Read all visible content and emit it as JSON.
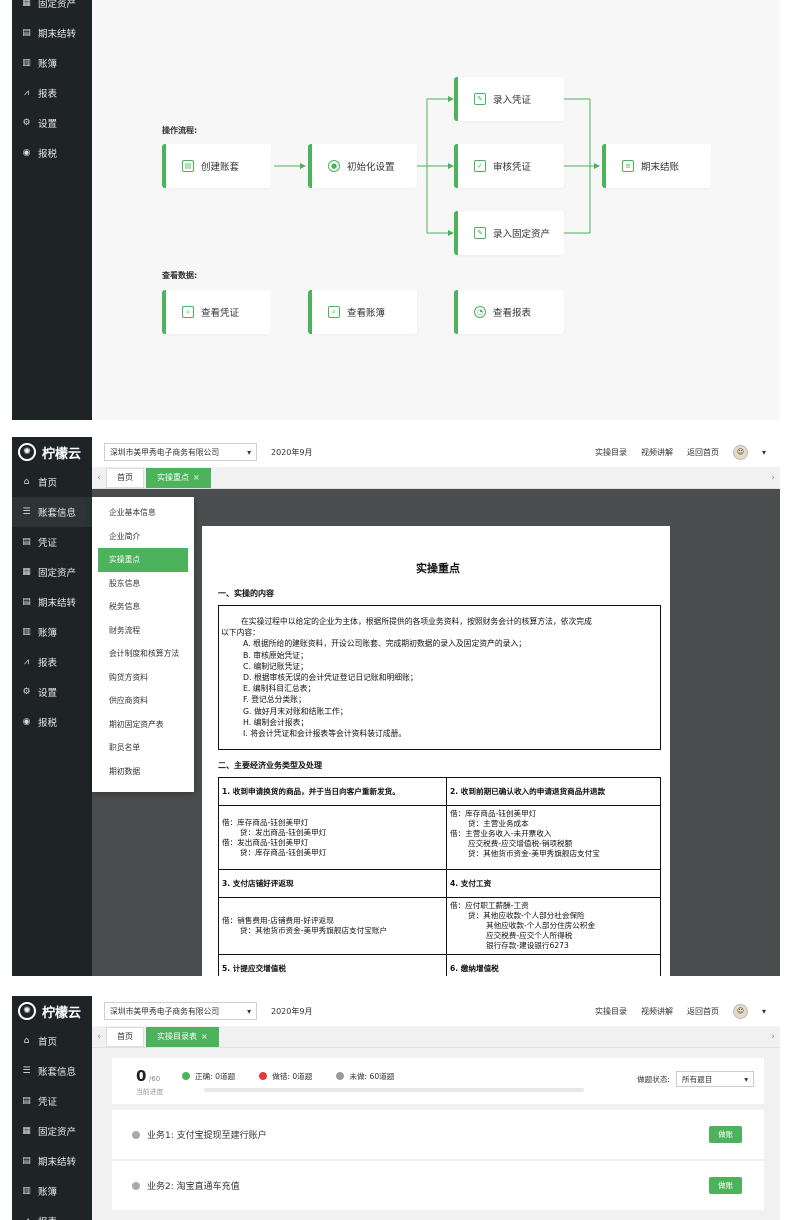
{
  "nav": [
    {
      "label": "首页",
      "icon": "home-icon"
    },
    {
      "label": "账套信息",
      "icon": "sliders-icon"
    },
    {
      "label": "凭证",
      "icon": "document-icon"
    },
    {
      "label": "固定资产",
      "icon": "building-icon"
    },
    {
      "label": "期末结转",
      "icon": "calendar-icon"
    },
    {
      "label": "账簿",
      "icon": "book-icon"
    },
    {
      "label": "报表",
      "icon": "chart-icon"
    },
    {
      "label": "设置",
      "icon": "gear-icon"
    },
    {
      "label": "报税",
      "icon": "tax-icon"
    }
  ],
  "brand": "柠檬云",
  "flow": {
    "operate_label": "操作流程:",
    "view_label": "查看数据:",
    "steps": {
      "create": "创建账套",
      "init": "初始化设置",
      "voucher_in": "录入凭证",
      "audit": "审核凭证",
      "asset_in": "录入固定资产",
      "close": "期末结账"
    },
    "views": {
      "voucher": "查看凭证",
      "books": "查看账簿",
      "report": "查看报表"
    }
  },
  "topbar": {
    "company": "深圳市美甲秀电子商务有限公司",
    "period": "2020年9月",
    "links": [
      "实操目录",
      "视频讲解",
      "返回首页"
    ]
  },
  "tabs_p2": [
    "首页",
    "实操重点"
  ],
  "tabs_p3": [
    "首页",
    "实操目录表"
  ],
  "dropdown": [
    "企业基本信息",
    "企业简介",
    "实操重点",
    "股东信息",
    "税务信息",
    "财务流程",
    "会计制度和核算方法",
    "购货方资料",
    "供应商资料",
    "期初固定资产表",
    "职员名单",
    "期初数据"
  ],
  "doc": {
    "title": "实操重点",
    "sec1": "一、实操的内容",
    "intro1": "在实操过程中以给定的企业为主体，根据所提供的各项业务资料，按照财务会计的核算方法，依次完成",
    "intro2": "以下内容：",
    "items": [
      "A. 根据所给的建账资料，开设公司账套、完成期初数据的录入及固定资产的录入；",
      "B. 审核原始凭证；",
      "C. 编制记账凭证；",
      "D. 根据审核无误的会计凭证登记日记账和明细账；",
      "E. 编制科目汇总表；",
      "F. 登记总分类账；",
      "G. 做好月末对账和结账工作；",
      "H. 编制会计报表；",
      "I. 将会计凭证和会计报表等会计资料装订成册。"
    ],
    "sec2": "二、主要经济业务类型及处理",
    "t": {
      "h1": "1. 收到申请换货的商品，并于当日向客户重新发货。",
      "h2": "2. 收到前期已确认收入的申请退货商品并退款",
      "c1": [
        "借：库存商品-钰创美甲灯",
        "贷：发出商品-钰创美甲灯",
        "借：发出商品-钰创美甲灯",
        "贷：库存商品-钰创美甲灯"
      ],
      "c2": [
        "借：库存商品-钰创美甲灯",
        "贷：主营业务成本",
        "借：主营业务收入-未开票收入",
        "应交税费-应交增值税-销项税额",
        "贷：其他货币资金-美甲秀旗舰店支付宝"
      ],
      "h3": "3. 支付店铺好评返现",
      "h4": "4. 支付工资",
      "c3": [
        "借：销售费用-店铺费用-好评返现",
        "贷：其他货币资金-美甲秀旗舰店支付宝账户"
      ],
      "c4": [
        "借：应付职工薪酬-工资",
        "贷：其他应收款-个人部分社会保险",
        "其他应收款-个人部分住房公积金",
        "应交税费-应交个人所得税",
        "银行存款-建设银行6273"
      ],
      "h5": "5. 计提应交增值税",
      "h6": "6. 缴纳增值税"
    }
  },
  "practice": {
    "done": "0",
    "total": "/60",
    "caption": "当前进度",
    "correct": "正确: 0道题",
    "wrong": "做错: 0道题",
    "undone": "未做: 60道题",
    "filter_label": "做题状态:",
    "filter_value": "所有题目",
    "tasks": [
      {
        "title": "业务1: 支付宝提现至建行账户",
        "btn": "做账"
      },
      {
        "title": "业务2: 淘宝直通车充值",
        "btn": "做账"
      }
    ],
    "colors": {
      "correct": "#4cb25b",
      "wrong": "#e03a3a",
      "undone": "#9a9a9a"
    }
  }
}
